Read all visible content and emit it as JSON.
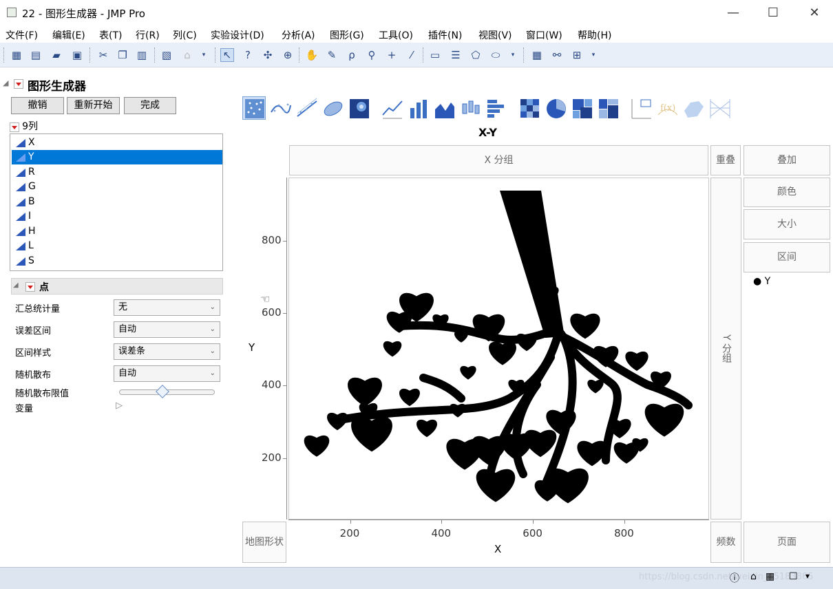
{
  "window": {
    "title": "22 - 图形生成器 - JMP Pro",
    "minimize": "—",
    "maximize": "☐",
    "close": "✕"
  },
  "menu": [
    "文件(F)",
    "编辑(E)",
    "表(T)",
    "行(R)",
    "列(C)",
    "实验设计(D)",
    "分析(A)",
    "图形(G)",
    "工具(O)",
    "插件(N)",
    "视图(V)",
    "窗口(W)",
    "帮助(H)"
  ],
  "toolbar_icons": [
    "new-table-icon",
    "new-script-icon",
    "open-icon",
    "save-icon",
    "cut-icon",
    "copy-icon",
    "paste-icon",
    "report-icon",
    "lock-icon",
    "arrow-icon",
    "help-icon",
    "crosshair-icon",
    "target-icon",
    "hand-icon",
    "brush-icon",
    "lasso-icon",
    "zoom-icon",
    "plus-icon",
    "line-icon",
    "text-icon",
    "list-icon",
    "polygon-icon",
    "ellipse-icon",
    "data-table-icon",
    "binoculars-icon",
    "add-icon"
  ],
  "graph_builder": {
    "title": "图形生成器",
    "buttons": {
      "undo": "撤销",
      "restart": "重新开始",
      "done": "完成"
    },
    "columns_label": "9列",
    "columns": [
      "X",
      "Y",
      "R",
      "G",
      "B",
      "I",
      "H",
      "L",
      "S"
    ],
    "selected_column": "Y",
    "points_section": "点",
    "properties": [
      {
        "label": "汇总统计量",
        "value": "无"
      },
      {
        "label": "误差区间",
        "value": "自动"
      },
      {
        "label": "区间样式",
        "value": "误差条"
      },
      {
        "label": "随机散布",
        "value": "自动"
      }
    ],
    "jitter_limit_label": "随机散布限值",
    "jitter_limit_value": 0.45,
    "variables_label": "变量"
  },
  "chart": {
    "heading": "X-Y",
    "zones": {
      "group_x": "X 分组",
      "overlap": "重叠",
      "overlay": "叠加",
      "color": "颜色",
      "size": "大小",
      "interval": "区间",
      "group_y": "Y 分组",
      "map_shape": "地图形状",
      "freq": "频数",
      "page": "页面"
    },
    "legend_item": "Y",
    "xlabel": "X",
    "ylabel": "Y"
  },
  "chart_data": {
    "type": "scatter",
    "title": "X-Y",
    "xlabel": "X",
    "ylabel": "Y",
    "x_ticks": [
      "200",
      "400",
      "600",
      "800"
    ],
    "y_ticks": [
      "800",
      "600",
      "400",
      "200"
    ],
    "xlim": [
      65,
      985
    ],
    "ylim": [
      30,
      975
    ],
    "note": "",
    "series": [
      {
        "name": "Y",
        "color": "#000000"
      }
    ]
  },
  "status": {
    "watermark": "https://blog.csdn.net/weixin_45183865"
  }
}
